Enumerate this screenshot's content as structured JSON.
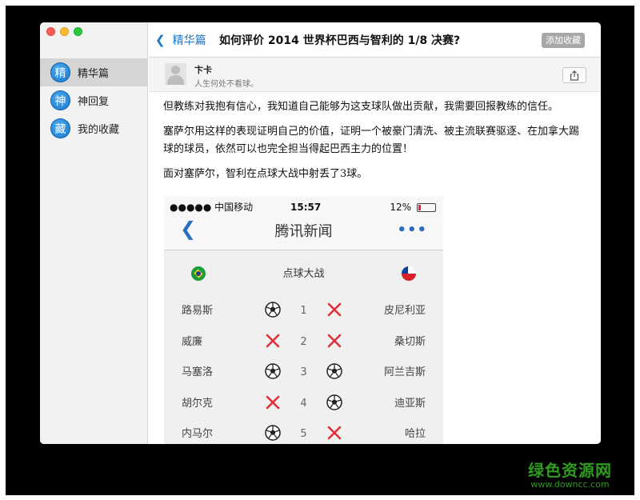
{
  "sidebar": {
    "items": [
      {
        "icon_char": "精",
        "label": "精华篇",
        "active": true
      },
      {
        "icon_char": "神",
        "label": "神回复",
        "active": false
      },
      {
        "icon_char": "藏",
        "label": "我的收藏",
        "active": false
      }
    ]
  },
  "header": {
    "back_label": "精华篇",
    "title": "如何评价 2014 世界杯巴西与智利的 1/8 决赛?",
    "favorite_label": "添加收藏"
  },
  "author": {
    "name": "卞卡",
    "bio": "人生何处不看球。"
  },
  "article": {
    "paragraphs": [
      "但教练对我抱有信心，我知道自己能够为这支球队做出贡献，我需要回报教练的信任。",
      "塞萨尔用这样的表现证明自己的价值，证明一个被豪门清洗、被主流联赛驱逐、在加拿大踢球的球员，依然可以也完全担当得起巴西主力的位置！",
      "面对塞萨尔，智利在点球大战中射丢了3球。"
    ]
  },
  "embedded": {
    "status": {
      "carrier": "●●●●● 中国移动",
      "time": "15:57",
      "battery": "12%"
    },
    "app_title": "腾讯新闻",
    "section_title": "点球大战",
    "rows": [
      {
        "left": "路易斯",
        "left_result": "goal",
        "num": "1",
        "right_result": "miss",
        "right": "皮尼利亚"
      },
      {
        "left": "威廉",
        "left_result": "miss",
        "num": "2",
        "right_result": "miss",
        "right": "桑切斯"
      },
      {
        "left": "马塞洛",
        "left_result": "goal",
        "num": "3",
        "right_result": "goal",
        "right": "阿兰吉斯"
      },
      {
        "left": "胡尔克",
        "left_result": "miss",
        "num": "4",
        "right_result": "goal",
        "right": "迪亚斯"
      },
      {
        "left": "内马尔",
        "left_result": "goal",
        "num": "5",
        "right_result": "miss",
        "right": "哈拉"
      }
    ]
  },
  "watermark": {
    "top": "绿色资源网",
    "bottom": "www.downcc.com"
  },
  "colors": {
    "accent": "#1c78c8",
    "miss": "#e0303a",
    "watermark": "#2f9b1f"
  }
}
